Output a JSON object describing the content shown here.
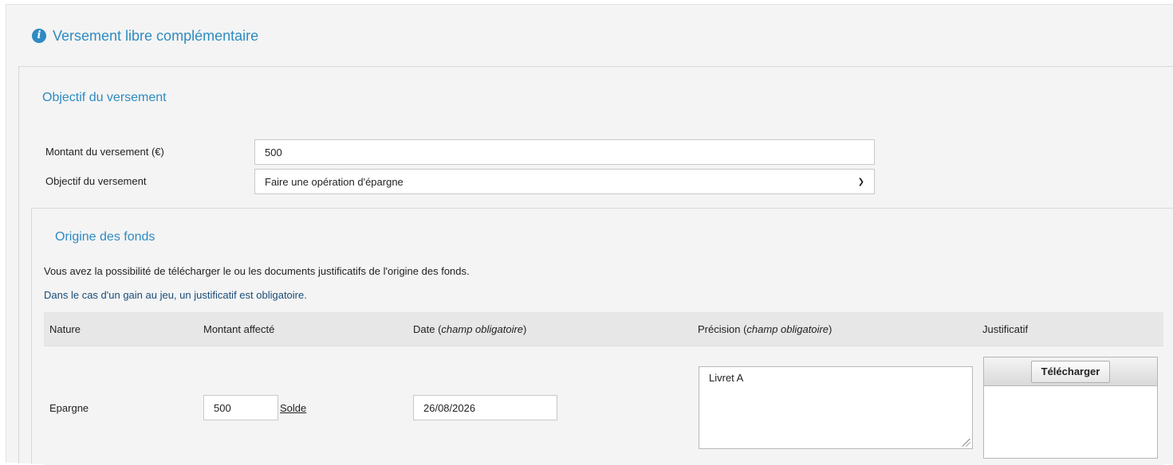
{
  "page": {
    "title": "Versement libre complémentaire",
    "title_icon": "info-icon"
  },
  "objectif_section": {
    "title": "Objectif du versement",
    "montant_label": "Montant du versement (€)",
    "montant_value": "500",
    "objectif_label": "Objectif du versement",
    "objectif_selected": "Faire une opération d'épargne"
  },
  "origine_section": {
    "title": "Origine des fonds",
    "description": "Vous avez la possibilité de télécharger le ou les documents justificatifs de l'origine des fonds.",
    "note": "Dans le cas d'un gain au jeu, un justificatif est obligatoire.",
    "table": {
      "headers": {
        "nature": "Nature",
        "montant": "Montant affecté",
        "date_prefix": "Date (",
        "date_em": "champ obligatoire",
        "date_suffix": ")",
        "precision_prefix": "Précision (",
        "precision_em": "champ obligatoire",
        "precision_suffix": ")",
        "justificatif": "Justificatif"
      },
      "rows": [
        {
          "nature": "Epargne",
          "montant": "500",
          "solde_link": "Solde",
          "date": "26/08/2026",
          "precision": "Livret A",
          "upload_label": "Télécharger"
        }
      ]
    }
  },
  "colors": {
    "accent": "#2e8bc2",
    "note": "#1a4c78",
    "background": "#f4f4f4"
  }
}
